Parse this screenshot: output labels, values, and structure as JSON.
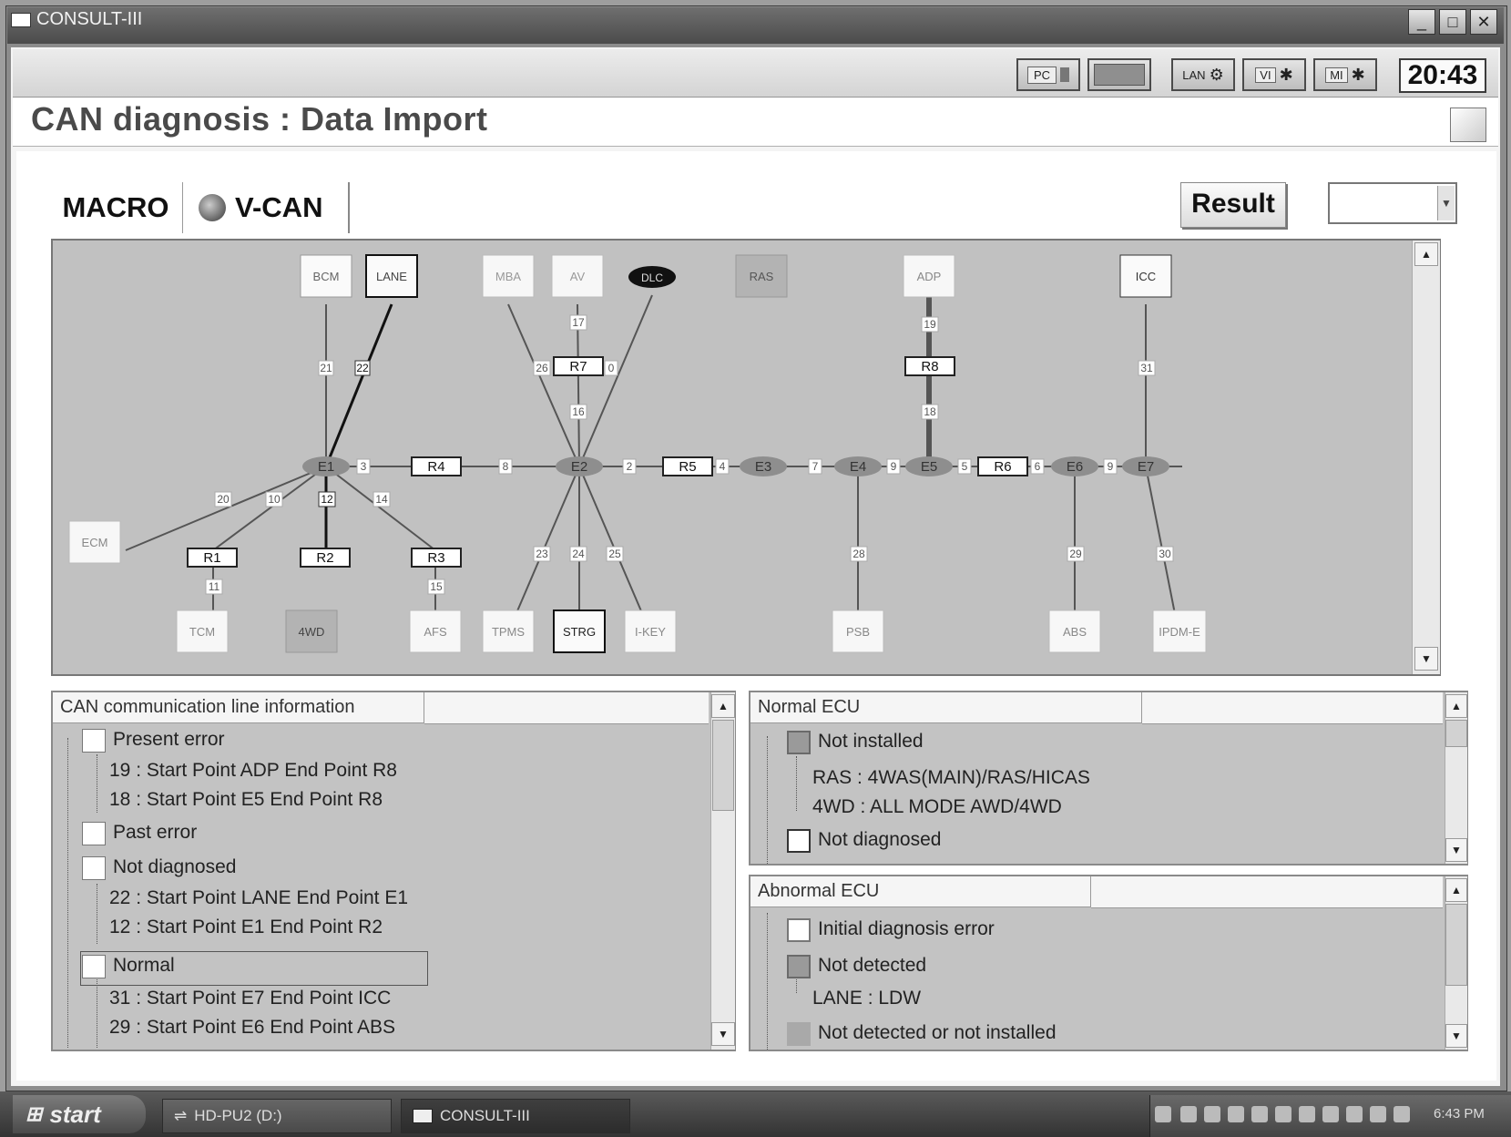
{
  "window": {
    "title": "CONSULT-III",
    "caption_buttons": [
      "_",
      "□",
      "✕"
    ]
  },
  "toolbar": {
    "icons": [
      {
        "name": "PC",
        "icon": "pc-icon"
      },
      {
        "name": "",
        "icon": "battery-icon"
      },
      {
        "name": "LAN",
        "icon": "lan-icon"
      },
      {
        "name": "VI",
        "icon": "vi-icon"
      },
      {
        "name": "MI",
        "icon": "mi-icon"
      }
    ],
    "clock": "20:43"
  },
  "page_title": "CAN diagnosis : Data Import",
  "tabs": {
    "macro": "MACRO",
    "vcan": "V-CAN"
  },
  "result_button": "Result",
  "result_select_value": "",
  "diagram": {
    "nodes": {
      "bcm": "BCM",
      "lane": "LANE",
      "mba": "MBA",
      "av": "AV",
      "dlc": "DLC",
      "ras": "RAS",
      "adp": "ADP",
      "icc": "ICC",
      "ecm": "ECM",
      "tcm": "TCM",
      "4wd": "4WD",
      "afs": "AFS",
      "tpms": "TPMS",
      "strg": "STRG",
      "ikey": "I-KEY",
      "psb": "PSB",
      "abs": "ABS",
      "ipdme": "IPDM-E"
    },
    "junctions": {
      "e1": "E1",
      "e2": "E2",
      "e3": "E3",
      "e4": "E4",
      "e5": "E5",
      "e6": "E6",
      "e7": "E7"
    },
    "relays": {
      "r1": "R1",
      "r2": "R2",
      "r3": "R3",
      "r4": "R4",
      "r5": "R5",
      "r6": "R6",
      "r7": "R7",
      "r8": "R8"
    },
    "line_labels": {
      "l21a": "21",
      "l22": "22",
      "l20": "20",
      "l10": "10",
      "l12": "12",
      "l14": "14",
      "l11": "11",
      "l15": "15",
      "l26": "26",
      "l17": "17",
      "l0": "0",
      "l16": "16",
      "l19": "19",
      "l18": "18",
      "l31": "31",
      "l3": "3",
      "l8": "8",
      "l2": "2",
      "l4": "4",
      "l7": "7",
      "l9": "9",
      "l5": "5",
      "l6": "6",
      "l9b": "9",
      "l23": "23",
      "l24": "24",
      "l25": "25",
      "l28": "28",
      "l29": "29",
      "l30": "30"
    }
  },
  "can_panel": {
    "header": "CAN communication line information",
    "groups": [
      {
        "label": "Present error",
        "items": [
          "19 : Start Point ADP End Point R8",
          "18 : Start Point E5 End Point R8"
        ]
      },
      {
        "label": "Past error",
        "items": []
      },
      {
        "label": "Not diagnosed",
        "items": [
          "22 : Start Point LANE End Point E1",
          "12 : Start Point E1 End Point R2"
        ]
      },
      {
        "label": "Normal",
        "items": [
          "31 : Start Point E7 End Point ICC",
          "29 : Start Point E6 End Point ABS"
        ]
      }
    ]
  },
  "normal_ecu_panel": {
    "header": "Normal ECU",
    "groups": [
      {
        "label": "Not installed",
        "items": [
          "RAS : 4WAS(MAIN)/RAS/HICAS",
          "4WD : ALL MODE AWD/4WD"
        ]
      },
      {
        "label": "Not diagnosed",
        "items": []
      }
    ]
  },
  "abnormal_ecu_panel": {
    "header": "Abnormal ECU",
    "groups": [
      {
        "label": "Initial diagnosis error",
        "items": []
      },
      {
        "label": "Not detected",
        "items": [
          "LANE : LDW"
        ]
      },
      {
        "label": "Not detected or not installed",
        "items": []
      }
    ]
  },
  "taskbar": {
    "start": "start",
    "items": [
      "HD-PU2 (D:)",
      "CONSULT-III"
    ],
    "time": "6:43 PM"
  }
}
